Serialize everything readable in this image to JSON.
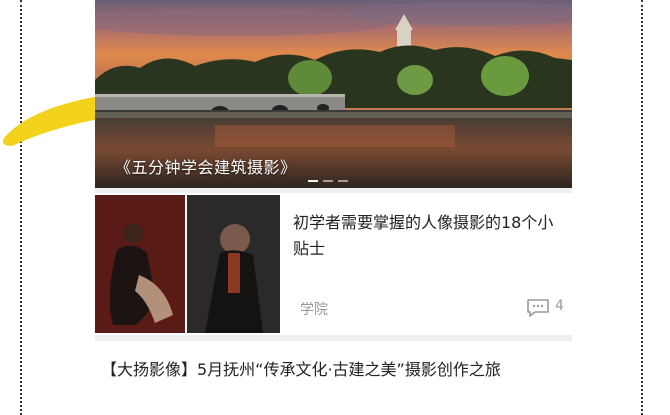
{
  "hero": {
    "caption": "《五分钟学会建筑摄影》",
    "slide_count": 3,
    "active_slide": 1
  },
  "articles": [
    {
      "title": "初学者需要掌握的人像摄影的18个小贴士",
      "source": "学院",
      "comment_count": "4",
      "icon": "comment-icon"
    },
    {
      "title": "【大扬影像】5月抚州“传承文化·古建之美”摄影创作之旅"
    }
  ],
  "colors": {
    "feed_background": "#efefef",
    "card_background": "#ffffff",
    "meta_text": "#9a9a9a",
    "highlight_mark": "#f2d21b"
  }
}
